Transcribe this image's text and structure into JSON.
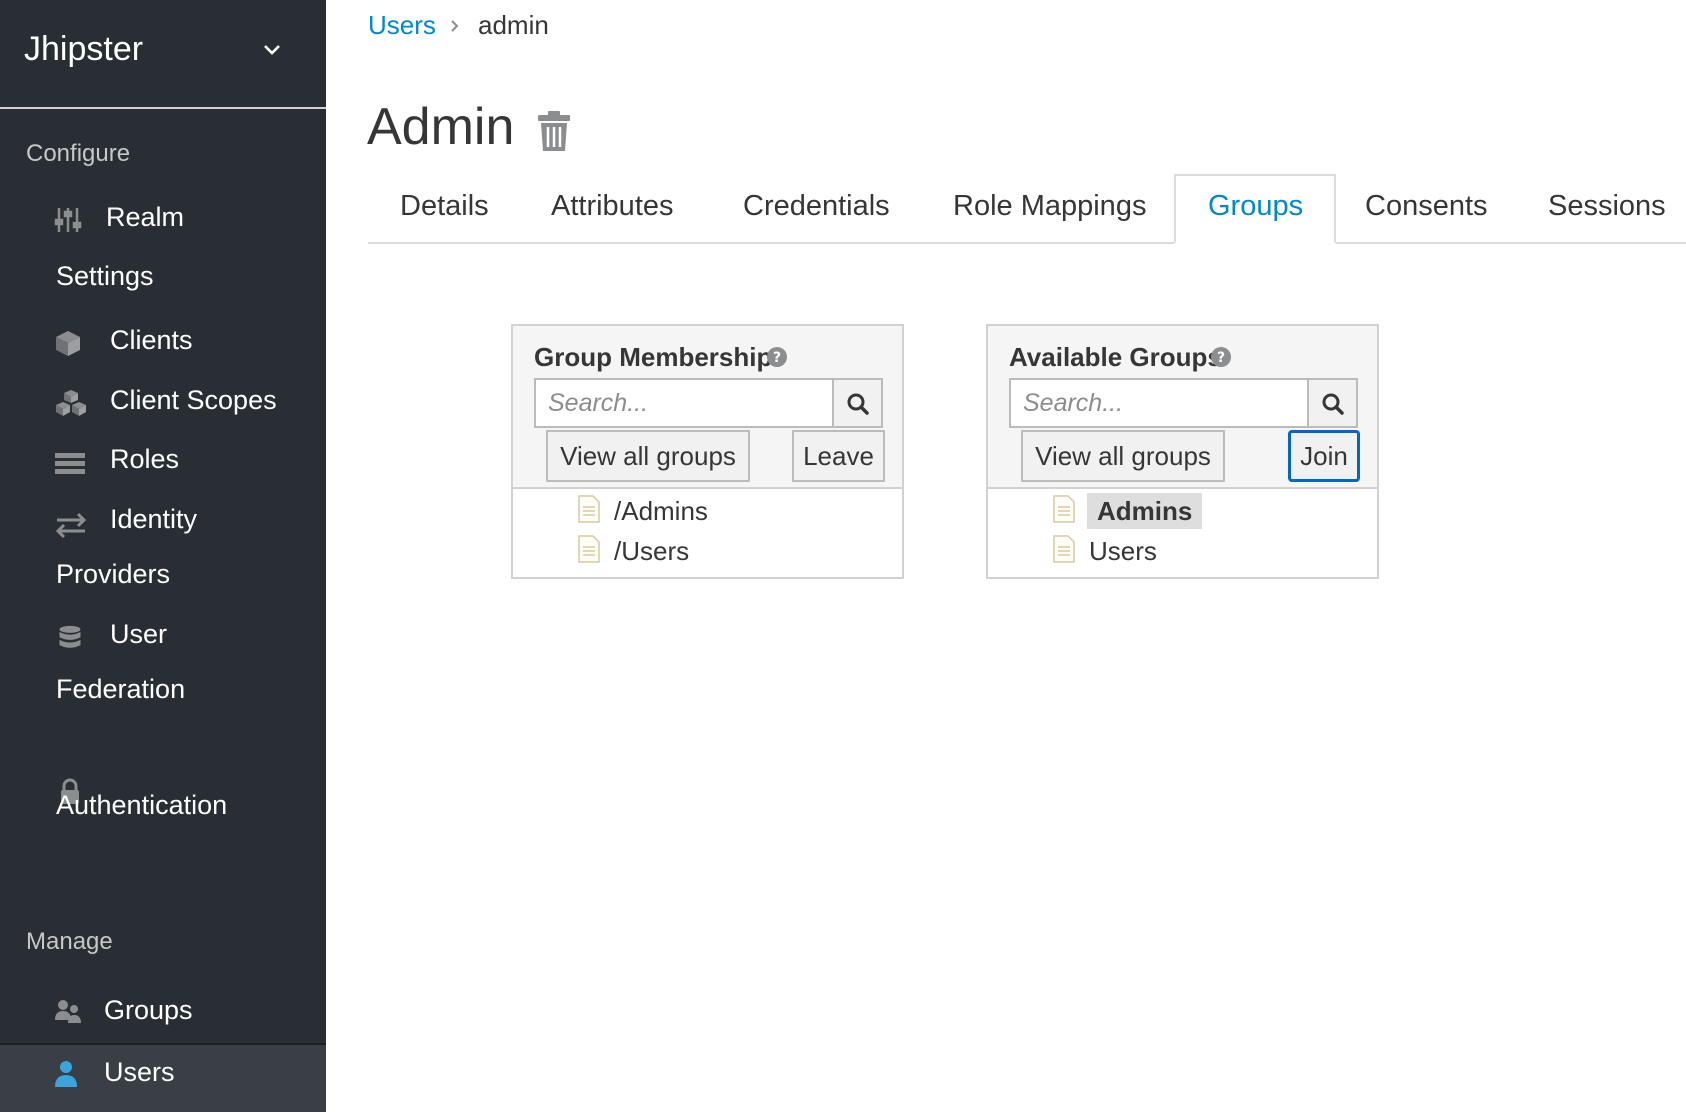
{
  "sidebar": {
    "realm": "Jhipster",
    "configure_title": "Configure",
    "configure_items": [
      {
        "label_lines": [
          "Realm",
          "Settings"
        ],
        "icon": "sliders-icon"
      },
      {
        "label_lines": [
          "Clients"
        ],
        "icon": "cube-icon"
      },
      {
        "label_lines": [
          "Client Scopes"
        ],
        "icon": "cubes-icon"
      },
      {
        "label_lines": [
          "Roles"
        ],
        "icon": "list-icon"
      },
      {
        "label_lines": [
          "Identity",
          "Providers"
        ],
        "icon": "exchange-icon"
      },
      {
        "label_lines": [
          "User",
          "Federation"
        ],
        "icon": "database-icon"
      },
      {
        "label_lines": [
          "Authentication"
        ],
        "icon": "lock-icon"
      }
    ],
    "manage_title": "Manage",
    "manage_items": [
      {
        "label": "Groups",
        "icon": "users-icon"
      },
      {
        "label": "Users",
        "icon": "user-icon",
        "active": true
      }
    ]
  },
  "breadcrumb": {
    "link": "Users",
    "current": "admin"
  },
  "page_title": "Admin",
  "tabs": [
    "Details",
    "Attributes",
    "Credentials",
    "Role Mappings",
    "Groups",
    "Consents",
    "Sessions"
  ],
  "active_tab": "Groups",
  "membership": {
    "title": "Group Membership",
    "search_placeholder": "Search...",
    "view_all_label": "View all groups",
    "action_label": "Leave",
    "items": [
      "/Admins",
      "/Users"
    ]
  },
  "available": {
    "title": "Available Groups",
    "search_placeholder": "Search...",
    "view_all_label": "View all groups",
    "action_label": "Join",
    "items": [
      "Admins",
      "Users"
    ],
    "selected": "Admins"
  },
  "colors": {
    "accent": "#0088ce",
    "sidebar": "#292e34",
    "focus": "#0066cc"
  }
}
